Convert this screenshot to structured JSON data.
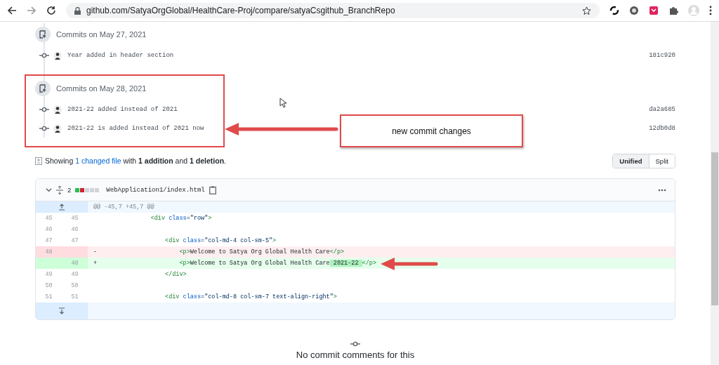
{
  "browser": {
    "url": "github.com/SatyaOrgGlobal/HealthCare-Proj/compare/satyaCsgithub_BranchRepo"
  },
  "commit_groups": [
    {
      "heading": "Commits on May 27, 2021",
      "commits": [
        {
          "message": "Year added in header section",
          "sha": "181c920"
        }
      ]
    },
    {
      "heading": "Commits on May 28, 2021",
      "commits": [
        {
          "message": "2021-22 added instead of 2021",
          "sha": "da2a685"
        },
        {
          "message": "2021-22 is added instead of 2021 now",
          "sha": "12db0d8"
        }
      ]
    }
  ],
  "callout": {
    "text": "new commit changes"
  },
  "summary": {
    "prefix": "Showing",
    "link": "1 changed file",
    "middle": "with **1 addition** and **1 deletion**."
  },
  "view_toggle": [
    {
      "label": "Unified",
      "selected": true
    },
    {
      "label": "Split",
      "selected": false
    }
  ],
  "file": {
    "count": "2",
    "stat": [
      {
        "color": "#2cbe4e"
      },
      {
        "color": "#cb2431"
      },
      {
        "color": "#d1d5da"
      },
      {
        "color": "#d1d5da"
      },
      {
        "color": "#d1d5da"
      }
    ],
    "path": "WebApplication1/index.html",
    "expanded": true,
    "lines": [
      {
        "kind": "hunk",
        "text": "@@ -45,7 +45,7 @@"
      },
      {
        "kind": "context",
        "old": "45",
        "new": "45",
        "segments": [
          {
            "t": "            <div class=\"row\">",
            "changed": false
          }
        ]
      },
      {
        "kind": "context",
        "old": "46",
        "new": "46"
      },
      {
        "kind": "context",
        "old": "47",
        "new": "47",
        "segments": [
          {
            "t": "                <div class=\"col-md-4 col-sm-5\">",
            "changed": false
          }
        ]
      },
      {
        "kind": "deletion",
        "old": "48",
        "sign": "-",
        "segments": [
          {
            "t": "                    <p>Welcome to Satya Org Global Health Care</p>",
            "changed": false
          }
        ]
      },
      {
        "kind": "addition",
        "new": "48",
        "sign": "+",
        "segments": [
          {
            "t": "                    <p>Welcome to Satya Org Global Health Care",
            "changed": false
          },
          {
            "t": " 2021-22 ",
            "changed": true
          },
          {
            "t": "</p>",
            "changed": false
          }
        ]
      },
      {
        "kind": "context",
        "old": "49",
        "new": "49",
        "segments": [
          {
            "t": "                </div>",
            "changed": false
          }
        ]
      },
      {
        "kind": "context",
        "old": "50",
        "new": "50"
      },
      {
        "kind": "context",
        "old": "51",
        "new": "51",
        "segments": [
          {
            "t": "                <div class=\"col-md-8 col-sm-7 text-align-right\">",
            "changed": false
          }
        ]
      },
      {
        "kind": "expand"
      }
    ]
  },
  "footer": {
    "text": "No commit comments for this"
  }
}
